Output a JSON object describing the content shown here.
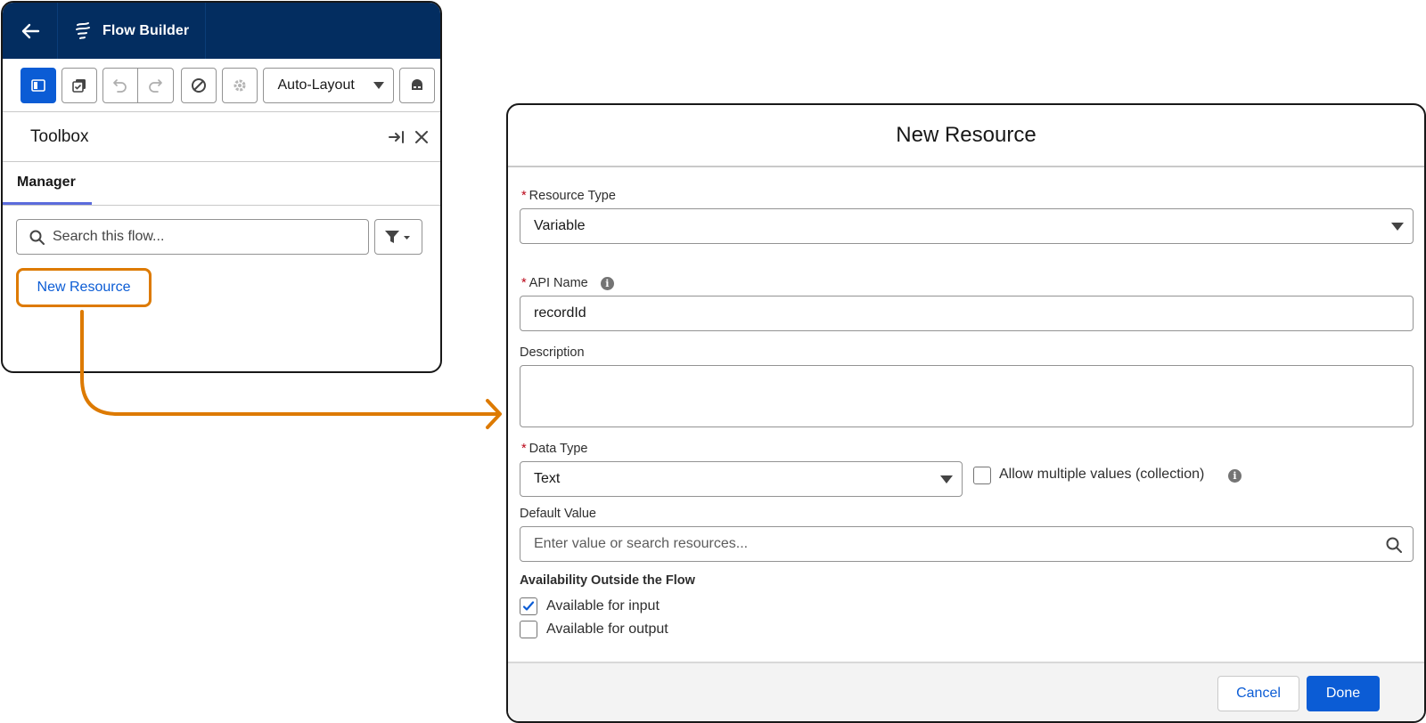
{
  "app": {
    "title": "Flow Builder"
  },
  "toolbar": {
    "layout_value": "Auto-Layout"
  },
  "toolbox": {
    "title": "Toolbox",
    "tab_manager": "Manager",
    "search_placeholder": "Search this flow...",
    "new_resource_label": "New Resource"
  },
  "modal": {
    "title": "New Resource",
    "resource_type_label": "Resource Type",
    "resource_type_value": "Variable",
    "api_name_label": "API Name",
    "api_name_value": "recordId",
    "description_label": "Description",
    "description_value": "",
    "data_type_label": "Data Type",
    "data_type_value": "Text",
    "allow_multiple_label": "Allow multiple values (collection)",
    "allow_multiple_checked": false,
    "default_value_label": "Default Value",
    "default_value_placeholder": "Enter value or search resources...",
    "availability_title": "Availability Outside the Flow",
    "available_input_label": "Available for input",
    "available_input_checked": true,
    "available_output_label": "Available for output",
    "available_output_checked": false,
    "cancel_label": "Cancel",
    "done_label": "Done"
  },
  "colors": {
    "header_bg": "#032d60",
    "brand_blue": "#0b5cd5",
    "highlight_orange": "#dd7a01",
    "required_red": "#ba0517"
  },
  "icons": [
    "back-arrow-icon",
    "flow-logo-icon",
    "toolbox-toggle-icon",
    "checklist-icon",
    "undo-icon",
    "redo-icon",
    "block-icon",
    "gear-icon",
    "dropdown-caret-icon",
    "debug-icon",
    "collapse-right-icon",
    "close-icon",
    "search-icon",
    "filter-icon",
    "info-icon",
    "checkmark-icon"
  ]
}
